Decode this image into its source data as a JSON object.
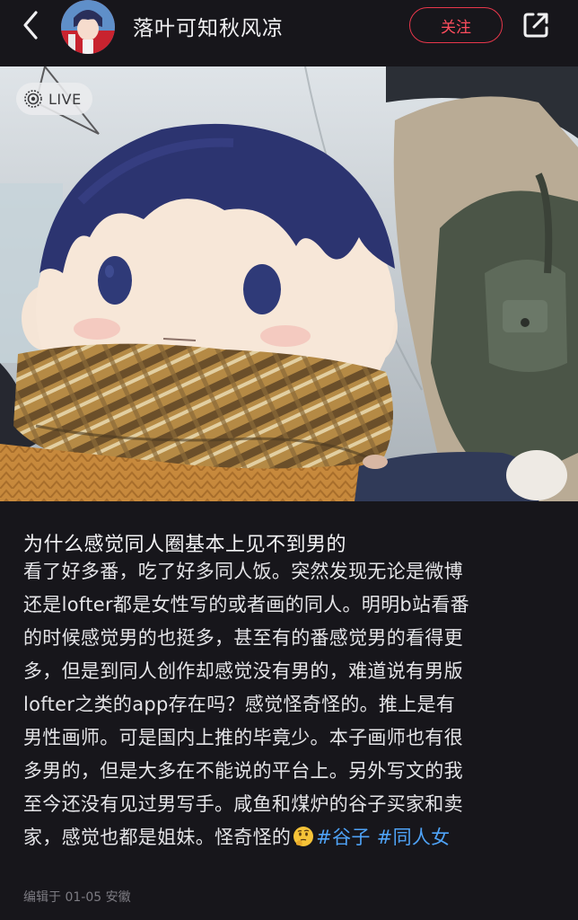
{
  "header": {
    "username": "落叶可知秋风凉",
    "follow_label": "关注"
  },
  "photo": {
    "live_label": "LIVE"
  },
  "post": {
    "title": "为什么感觉同人圈基本上见不到男的",
    "lines": [
      "看了好多番，吃了好多同人饭。突然发现无论是微博",
      "还是lofter都是女性写的或者画的同人。明明b站看番",
      "的时候感觉男的也挺多，甚至有的番感觉男的看得更",
      "多，但是到同人创作却感觉没有男的，难道说有男版",
      "lofter之类的app存在吗？感觉怪奇怪的。推上是有",
      "男性画师。可是国内上推的毕竟少。本子画师也有很",
      "多男的，但是大多在不能说的平台上。另外写文的我",
      "至今还没有见过男写手。咸鱼和煤炉的谷子买家和卖",
      "家，感觉也都是姐妹。怪奇怪的"
    ],
    "tags": [
      "#谷子",
      "#同人女"
    ],
    "edit_meta": "编辑于 01-05 安徽"
  },
  "colors": {
    "background": "#17161b",
    "follow_accent": "#e8374b",
    "tag": "#4fa3f7"
  },
  "icons": {
    "back": "chevron-left-icon",
    "share": "share-icon",
    "live": "live-photo-icon",
    "emoji": "thinking-face-emoji"
  }
}
